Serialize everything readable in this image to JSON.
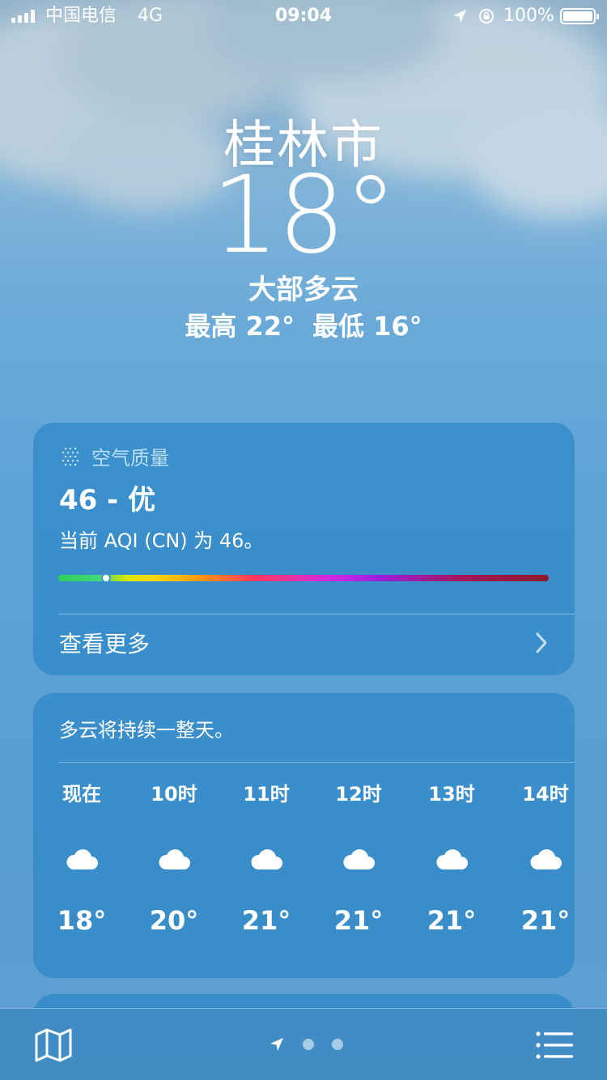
{
  "status_bar": {
    "carrier": "中国电信",
    "network": "4G",
    "time": "09:04",
    "battery": "100%"
  },
  "header": {
    "city": "桂林市",
    "temperature": "18°",
    "condition": "大部多云",
    "high": "最高 22°",
    "low": "最低 16°"
  },
  "air_quality": {
    "title": "空气质量",
    "value": "46 - 优",
    "description": "当前 AQI (CN) 为 46。",
    "level": 0.1,
    "see_more": "查看更多"
  },
  "forecast": {
    "summary": "多云将持续一整天。",
    "hours": [
      {
        "label": "现在",
        "icon": "cloud-icon",
        "temp": "18°"
      },
      {
        "label": "10时",
        "icon": "cloud-icon",
        "temp": "20°"
      },
      {
        "label": "11时",
        "icon": "cloud-icon",
        "temp": "21°"
      },
      {
        "label": "12时",
        "icon": "cloud-icon",
        "temp": "21°"
      },
      {
        "label": "13时",
        "icon": "cloud-icon",
        "temp": "21°"
      },
      {
        "label": "14时",
        "icon": "cloud-icon",
        "temp": "21°"
      }
    ]
  },
  "toolbar": {
    "map_icon": "map-icon",
    "list_icon": "list-icon",
    "pages": 3
  }
}
